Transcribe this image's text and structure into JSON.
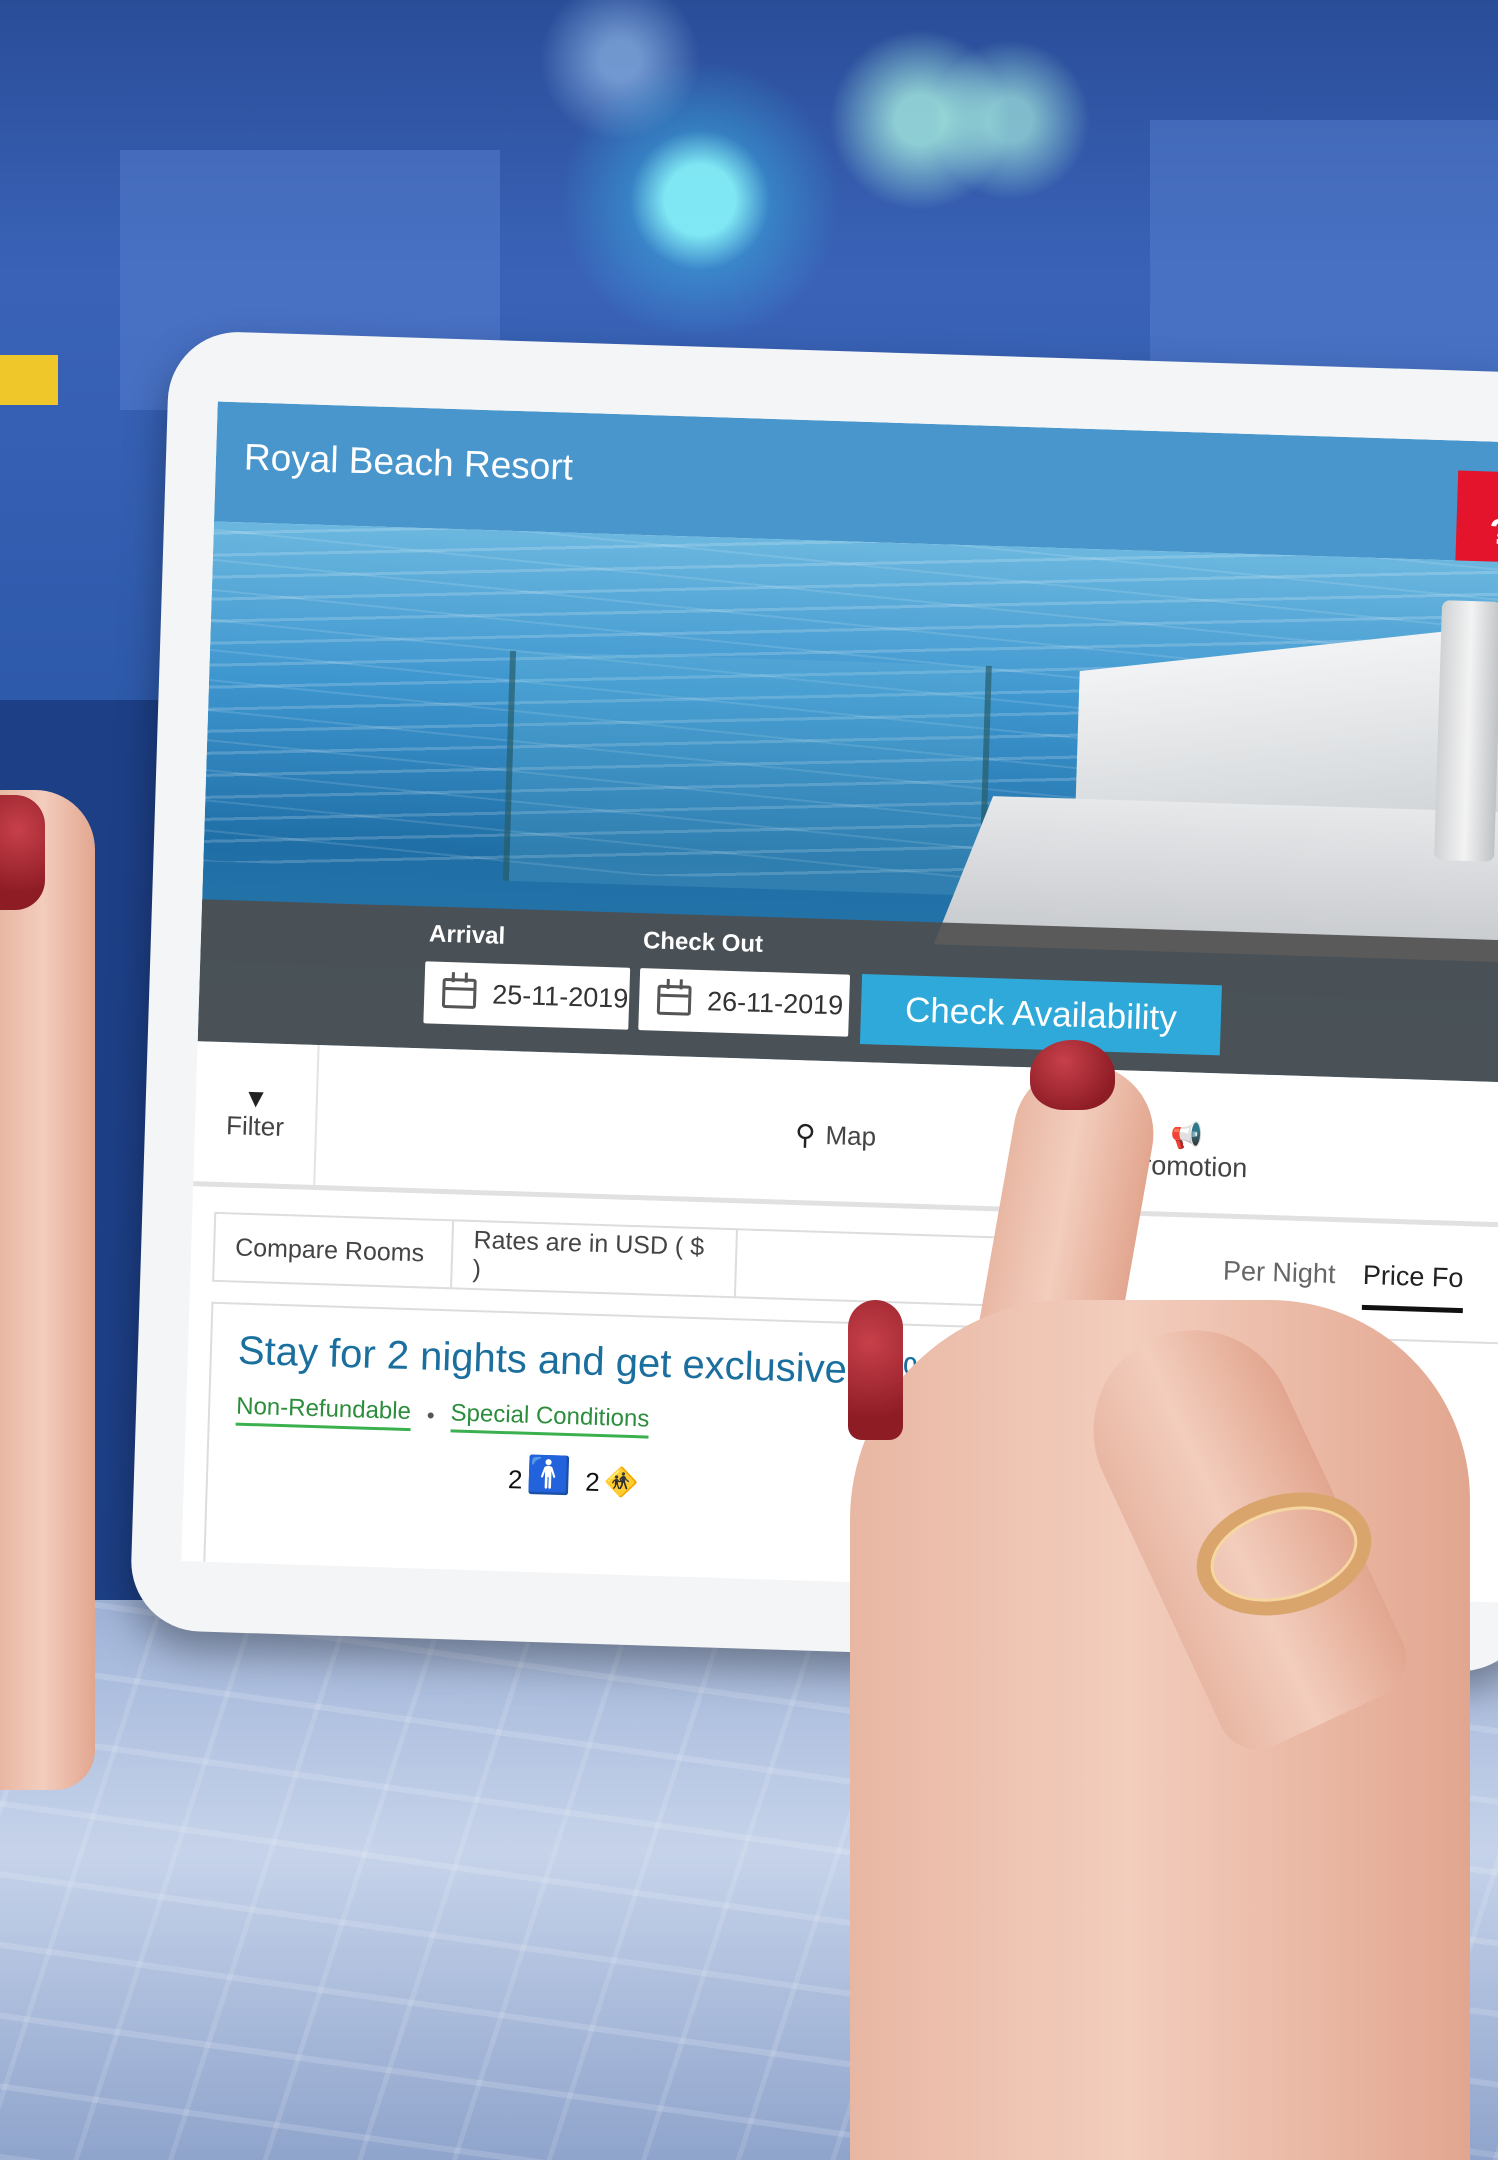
{
  "header": {
    "title": "Royal Beach Resort",
    "help_label": "?"
  },
  "booking": {
    "arrival_label": "Arrival",
    "arrival_value": "25-11-2019",
    "checkout_label": "Check Out",
    "checkout_value": "26-11-2019",
    "check_button_label": "Check Availability"
  },
  "toolbar": {
    "filter_label": "Filter",
    "map_label": "Map",
    "promotion_label": "Promotion"
  },
  "options": {
    "compare_label": "Compare Rooms",
    "currency_label": "Rates are in USD ( $ )",
    "tabs": [
      {
        "label": "Per Night"
      },
      {
        "label": "Price Fo"
      }
    ]
  },
  "offer": {
    "title": "Stay for 2 nights and get exclusive 20%",
    "non_refundable": "Non-Refundable",
    "special_conditions": "Special Conditions",
    "separator": "•",
    "adults_count": "2",
    "children_count": "2"
  },
  "icons": {
    "filter": "funnel-icon",
    "map": "map-pin-icon",
    "promotion": "megaphone-icon",
    "calendar": "calendar-icon"
  },
  "colors": {
    "header_blue": "#4896cc",
    "help_red": "#e3142b",
    "button_blue": "#2fa9d9",
    "offer_title": "#1b6f9e",
    "tag_green": "#2c8d3c"
  }
}
